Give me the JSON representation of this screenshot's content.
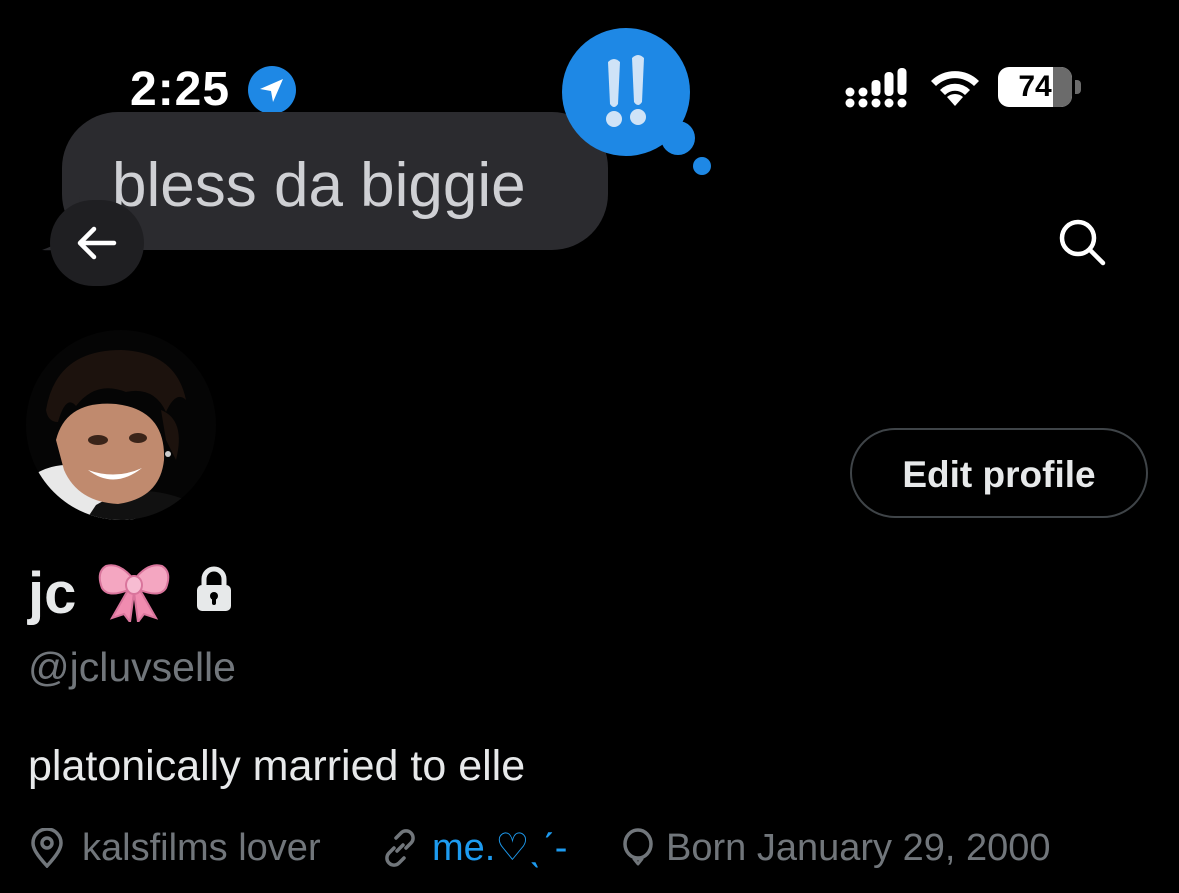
{
  "status_bar": {
    "time": "2:25",
    "battery_percent": "74",
    "battery_level": 0.74
  },
  "sticker": {
    "bubble_text": "bless da biggie",
    "emphasis_mark": "!!"
  },
  "nav": {
    "back_icon": "arrow-left-icon",
    "search_icon": "search-icon"
  },
  "profile": {
    "display_name": "jc",
    "name_emoji": "bow-icon",
    "protected_icon": "lock-icon",
    "handle": "@jcluvselle",
    "edit_button_label": "Edit profile",
    "bio": "platonically married to elle",
    "location": "kalsfilms lover",
    "link": "me.♡ˎˊ-",
    "birthday": "Born January 29, 2000"
  },
  "colors": {
    "background": "#000000",
    "text_primary": "#e7e9ea",
    "text_secondary": "#71767b",
    "accent": "#1d9bf0",
    "emphasis_blue": "#1e88e5",
    "bow_pink": "#f4a6c1"
  }
}
